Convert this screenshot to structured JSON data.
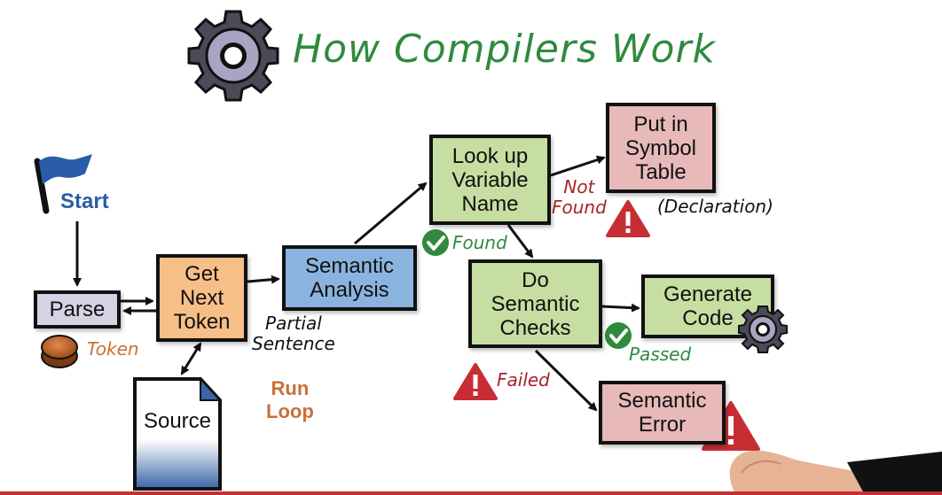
{
  "title": "How Compilers Work",
  "start_label": "Start",
  "nodes": {
    "parse": "Parse",
    "get_next_token": "Get\nNext\nToken",
    "semantic_analysis": "Semantic\nAnalysis",
    "look_up_variable": "Look up\nVariable\nName",
    "put_in_symbol_table": "Put in\nSymbol\nTable",
    "do_semantic_checks": "Do\nSemantic\nChecks",
    "generate_code": "Generate\nCode",
    "semantic_error": "Semantic\nError",
    "source": "Source"
  },
  "labels": {
    "token": "Token",
    "partial_sentence": "Partial\nSentence",
    "found": "Found",
    "not_found": "Not\nFound",
    "declaration": "(Declaration)",
    "passed": "Passed",
    "failed": "Failed",
    "run_loop": "Run\nLoop"
  },
  "colors": {
    "title": "#2f8a3e",
    "green_box": "#c6dea1",
    "pink_box": "#e8b9b9",
    "blue_box": "#8ab4df",
    "orange_box": "#f7bf88",
    "lilac_box": "#d6d1e3",
    "warning_red": "#c62e34",
    "check_green": "#2f8a3e",
    "start_blue": "#2a5da8"
  },
  "icons": [
    "gear-icon",
    "flag-icon",
    "coin-icon",
    "check-icon",
    "warning-icon",
    "document-icon",
    "hand-icon"
  ]
}
